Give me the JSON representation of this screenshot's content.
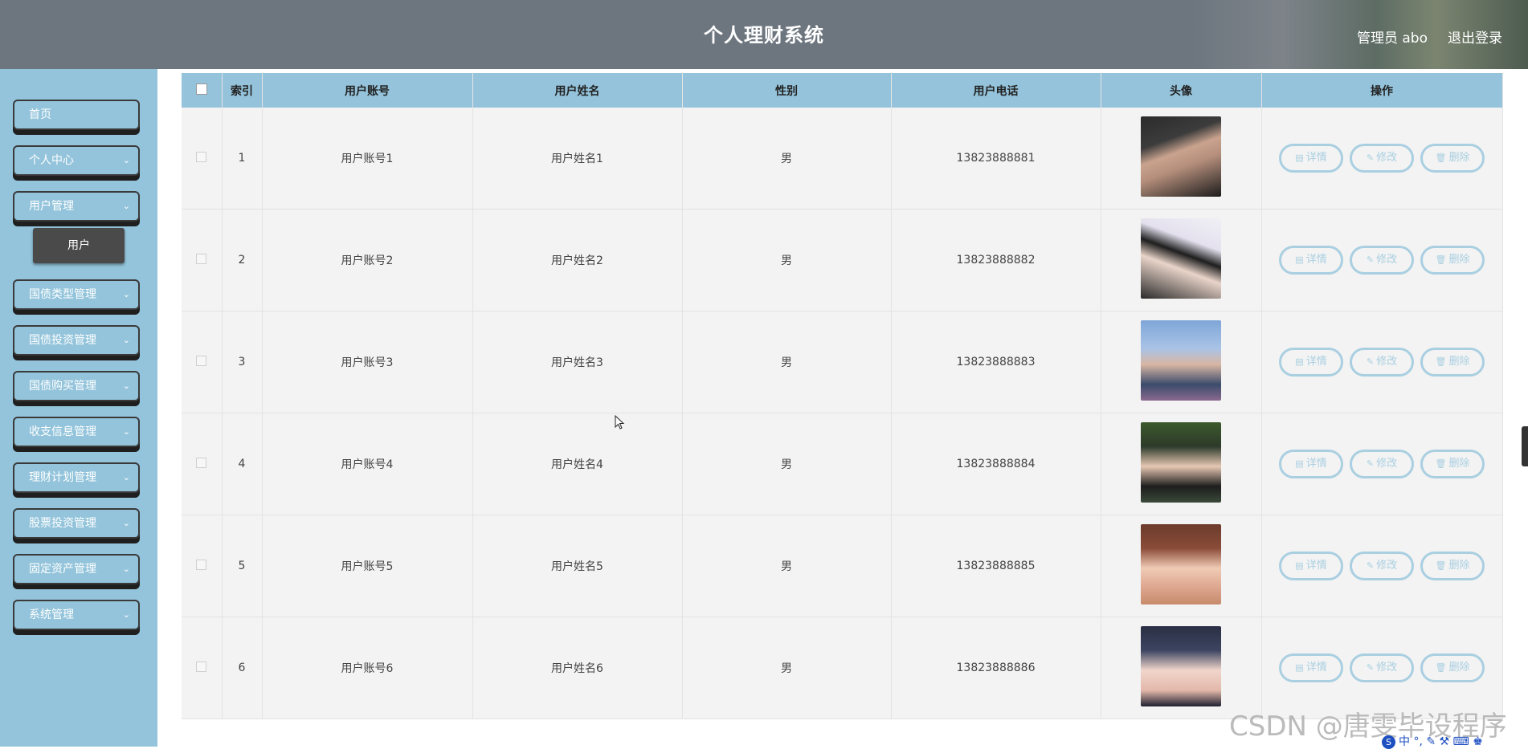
{
  "header": {
    "title": "个人理财系统",
    "user_label": "管理员 abo",
    "logout_label": "退出登录"
  },
  "sidebar": {
    "items": [
      {
        "label": "首页",
        "has_chevron": false
      },
      {
        "label": "个人中心",
        "has_chevron": true
      },
      {
        "label": "用户管理",
        "has_chevron": true
      },
      {
        "label": "国债类型管理",
        "has_chevron": true
      },
      {
        "label": "国债投资管理",
        "has_chevron": true
      },
      {
        "label": "国债购买管理",
        "has_chevron": true
      },
      {
        "label": "收支信息管理",
        "has_chevron": true
      },
      {
        "label": "理财计划管理",
        "has_chevron": true
      },
      {
        "label": "股票投资管理",
        "has_chevron": true
      },
      {
        "label": "固定资产管理",
        "has_chevron": true
      },
      {
        "label": "系统管理",
        "has_chevron": true
      }
    ],
    "submenu_active": "用户"
  },
  "table": {
    "headers": [
      "索引",
      "用户账号",
      "用户姓名",
      "性别",
      "用户电话",
      "头像",
      "操作"
    ],
    "rows": [
      {
        "index": "1",
        "account": "用户账号1",
        "name": "用户姓名1",
        "gender": "男",
        "phone": "13823888881"
      },
      {
        "index": "2",
        "account": "用户账号2",
        "name": "用户姓名2",
        "gender": "男",
        "phone": "13823888882"
      },
      {
        "index": "3",
        "account": "用户账号3",
        "name": "用户姓名3",
        "gender": "男",
        "phone": "13823888883"
      },
      {
        "index": "4",
        "account": "用户账号4",
        "name": "用户姓名4",
        "gender": "男",
        "phone": "13823888884"
      },
      {
        "index": "5",
        "account": "用户账号5",
        "name": "用户姓名5",
        "gender": "男",
        "phone": "13823888885"
      },
      {
        "index": "6",
        "account": "用户账号6",
        "name": "用户姓名6",
        "gender": "男",
        "phone": "13823888886"
      }
    ],
    "actions": {
      "detail": "详情",
      "edit": "修改",
      "delete": "删除"
    }
  },
  "watermark": "CSDN @唐雯毕设程序",
  "ime": {
    "logo": "S",
    "text": "中 °, ✎ ⚒ ⌨ ♚"
  },
  "colors": {
    "accent": "#94c3db",
    "sidebar": "#93c4db",
    "header": "#6d767f",
    "button_border": "#a9cfe1"
  }
}
